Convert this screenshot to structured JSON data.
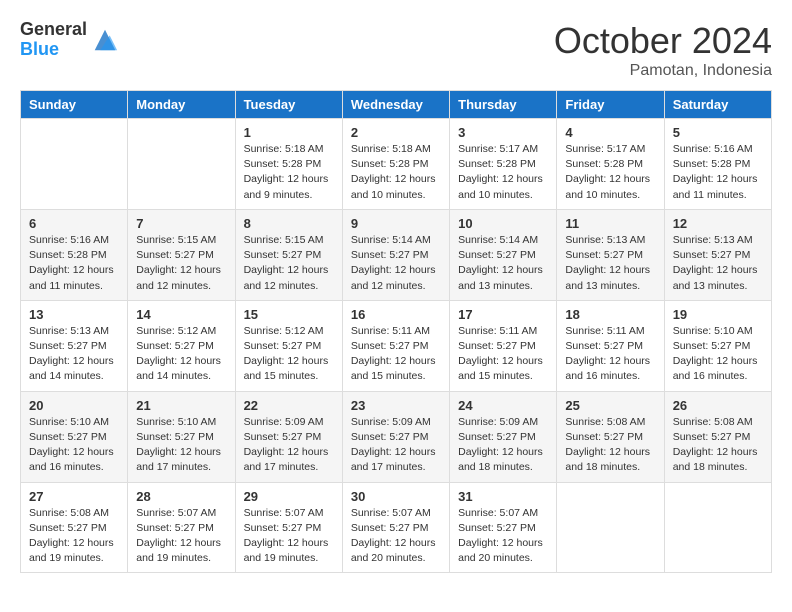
{
  "logo": {
    "general": "General",
    "blue": "Blue"
  },
  "title": {
    "month": "October 2024",
    "location": "Pamotan, Indonesia"
  },
  "weekdays": [
    "Sunday",
    "Monday",
    "Tuesday",
    "Wednesday",
    "Thursday",
    "Friday",
    "Saturday"
  ],
  "weeks": [
    [
      {
        "day": "",
        "info": ""
      },
      {
        "day": "",
        "info": ""
      },
      {
        "day": "1",
        "sunrise": "Sunrise: 5:18 AM",
        "sunset": "Sunset: 5:28 PM",
        "daylight": "Daylight: 12 hours and 9 minutes."
      },
      {
        "day": "2",
        "sunrise": "Sunrise: 5:18 AM",
        "sunset": "Sunset: 5:28 PM",
        "daylight": "Daylight: 12 hours and 10 minutes."
      },
      {
        "day": "3",
        "sunrise": "Sunrise: 5:17 AM",
        "sunset": "Sunset: 5:28 PM",
        "daylight": "Daylight: 12 hours and 10 minutes."
      },
      {
        "day": "4",
        "sunrise": "Sunrise: 5:17 AM",
        "sunset": "Sunset: 5:28 PM",
        "daylight": "Daylight: 12 hours and 10 minutes."
      },
      {
        "day": "5",
        "sunrise": "Sunrise: 5:16 AM",
        "sunset": "Sunset: 5:28 PM",
        "daylight": "Daylight: 12 hours and 11 minutes."
      }
    ],
    [
      {
        "day": "6",
        "sunrise": "Sunrise: 5:16 AM",
        "sunset": "Sunset: 5:28 PM",
        "daylight": "Daylight: 12 hours and 11 minutes."
      },
      {
        "day": "7",
        "sunrise": "Sunrise: 5:15 AM",
        "sunset": "Sunset: 5:27 PM",
        "daylight": "Daylight: 12 hours and 12 minutes."
      },
      {
        "day": "8",
        "sunrise": "Sunrise: 5:15 AM",
        "sunset": "Sunset: 5:27 PM",
        "daylight": "Daylight: 12 hours and 12 minutes."
      },
      {
        "day": "9",
        "sunrise": "Sunrise: 5:14 AM",
        "sunset": "Sunset: 5:27 PM",
        "daylight": "Daylight: 12 hours and 12 minutes."
      },
      {
        "day": "10",
        "sunrise": "Sunrise: 5:14 AM",
        "sunset": "Sunset: 5:27 PM",
        "daylight": "Daylight: 12 hours and 13 minutes."
      },
      {
        "day": "11",
        "sunrise": "Sunrise: 5:13 AM",
        "sunset": "Sunset: 5:27 PM",
        "daylight": "Daylight: 12 hours and 13 minutes."
      },
      {
        "day": "12",
        "sunrise": "Sunrise: 5:13 AM",
        "sunset": "Sunset: 5:27 PM",
        "daylight": "Daylight: 12 hours and 13 minutes."
      }
    ],
    [
      {
        "day": "13",
        "sunrise": "Sunrise: 5:13 AM",
        "sunset": "Sunset: 5:27 PM",
        "daylight": "Daylight: 12 hours and 14 minutes."
      },
      {
        "day": "14",
        "sunrise": "Sunrise: 5:12 AM",
        "sunset": "Sunset: 5:27 PM",
        "daylight": "Daylight: 12 hours and 14 minutes."
      },
      {
        "day": "15",
        "sunrise": "Sunrise: 5:12 AM",
        "sunset": "Sunset: 5:27 PM",
        "daylight": "Daylight: 12 hours and 15 minutes."
      },
      {
        "day": "16",
        "sunrise": "Sunrise: 5:11 AM",
        "sunset": "Sunset: 5:27 PM",
        "daylight": "Daylight: 12 hours and 15 minutes."
      },
      {
        "day": "17",
        "sunrise": "Sunrise: 5:11 AM",
        "sunset": "Sunset: 5:27 PM",
        "daylight": "Daylight: 12 hours and 15 minutes."
      },
      {
        "day": "18",
        "sunrise": "Sunrise: 5:11 AM",
        "sunset": "Sunset: 5:27 PM",
        "daylight": "Daylight: 12 hours and 16 minutes."
      },
      {
        "day": "19",
        "sunrise": "Sunrise: 5:10 AM",
        "sunset": "Sunset: 5:27 PM",
        "daylight": "Daylight: 12 hours and 16 minutes."
      }
    ],
    [
      {
        "day": "20",
        "sunrise": "Sunrise: 5:10 AM",
        "sunset": "Sunset: 5:27 PM",
        "daylight": "Daylight: 12 hours and 16 minutes."
      },
      {
        "day": "21",
        "sunrise": "Sunrise: 5:10 AM",
        "sunset": "Sunset: 5:27 PM",
        "daylight": "Daylight: 12 hours and 17 minutes."
      },
      {
        "day": "22",
        "sunrise": "Sunrise: 5:09 AM",
        "sunset": "Sunset: 5:27 PM",
        "daylight": "Daylight: 12 hours and 17 minutes."
      },
      {
        "day": "23",
        "sunrise": "Sunrise: 5:09 AM",
        "sunset": "Sunset: 5:27 PM",
        "daylight": "Daylight: 12 hours and 17 minutes."
      },
      {
        "day": "24",
        "sunrise": "Sunrise: 5:09 AM",
        "sunset": "Sunset: 5:27 PM",
        "daylight": "Daylight: 12 hours and 18 minutes."
      },
      {
        "day": "25",
        "sunrise": "Sunrise: 5:08 AM",
        "sunset": "Sunset: 5:27 PM",
        "daylight": "Daylight: 12 hours and 18 minutes."
      },
      {
        "day": "26",
        "sunrise": "Sunrise: 5:08 AM",
        "sunset": "Sunset: 5:27 PM",
        "daylight": "Daylight: 12 hours and 18 minutes."
      }
    ],
    [
      {
        "day": "27",
        "sunrise": "Sunrise: 5:08 AM",
        "sunset": "Sunset: 5:27 PM",
        "daylight": "Daylight: 12 hours and 19 minutes."
      },
      {
        "day": "28",
        "sunrise": "Sunrise: 5:07 AM",
        "sunset": "Sunset: 5:27 PM",
        "daylight": "Daylight: 12 hours and 19 minutes."
      },
      {
        "day": "29",
        "sunrise": "Sunrise: 5:07 AM",
        "sunset": "Sunset: 5:27 PM",
        "daylight": "Daylight: 12 hours and 19 minutes."
      },
      {
        "day": "30",
        "sunrise": "Sunrise: 5:07 AM",
        "sunset": "Sunset: 5:27 PM",
        "daylight": "Daylight: 12 hours and 20 minutes."
      },
      {
        "day": "31",
        "sunrise": "Sunrise: 5:07 AM",
        "sunset": "Sunset: 5:27 PM",
        "daylight": "Daylight: 12 hours and 20 minutes."
      },
      {
        "day": "",
        "info": ""
      },
      {
        "day": "",
        "info": ""
      }
    ]
  ]
}
